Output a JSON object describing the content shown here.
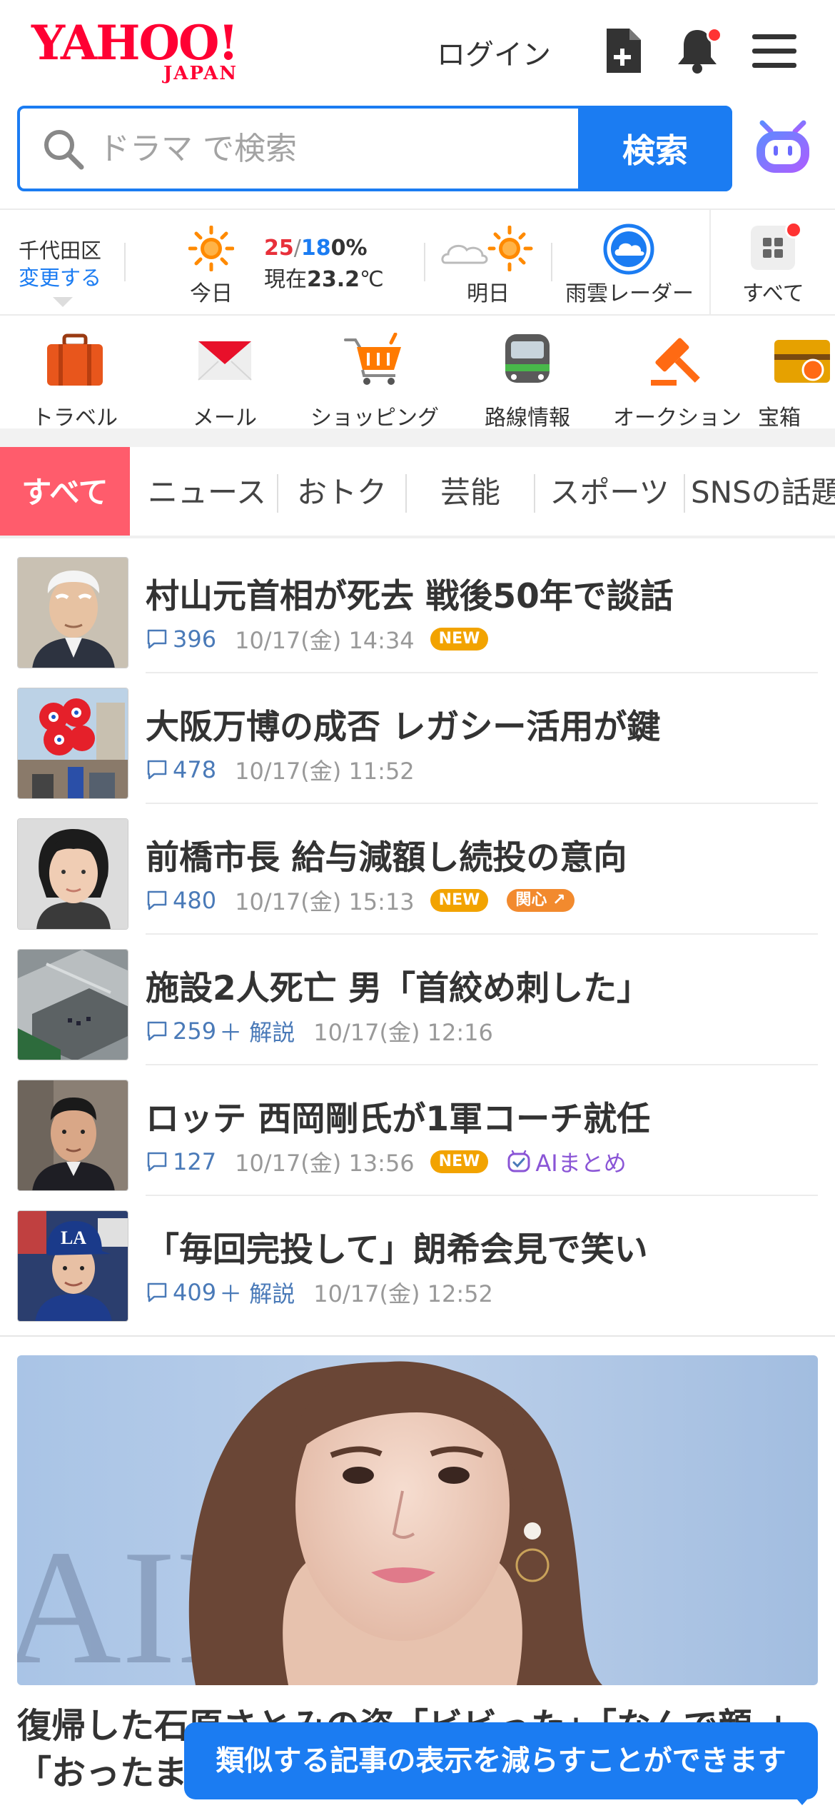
{
  "header": {
    "logo_main": "YAHOO!",
    "logo_sub": "JAPAN",
    "login_label": "ログイン",
    "icons": [
      "add-document-icon",
      "bell-icon",
      "hamburger-menu-icon"
    ]
  },
  "search": {
    "placeholder": "ドラマ で検索",
    "value": "",
    "button_label": "検索"
  },
  "weather": {
    "area": "千代田区",
    "change_label": "変更する",
    "today_label": "今日",
    "high": "25",
    "slash": "/",
    "low": "18",
    "rain": "0%",
    "now_prefix": "現在",
    "now_temp": "23.2",
    "now_unit": "℃",
    "tomorrow_label": "明日",
    "radar_label": "雨雲レーダー",
    "all_label": "すべて"
  },
  "services": [
    {
      "label": "トラベル",
      "icon": "suitcase-icon"
    },
    {
      "label": "メール",
      "icon": "mail-icon"
    },
    {
      "label": "ショッピング",
      "icon": "cart-icon"
    },
    {
      "label": "路線情報",
      "icon": "train-icon"
    },
    {
      "label": "オークション",
      "icon": "gavel-icon"
    },
    {
      "label": "宝箱",
      "icon": "treasure-box-icon"
    }
  ],
  "tabs": [
    {
      "label": "すべて",
      "active": true
    },
    {
      "label": "ニュース"
    },
    {
      "label": "おトク"
    },
    {
      "label": "芸能"
    },
    {
      "label": "スポーツ"
    },
    {
      "label": "SNSの話題"
    }
  ],
  "news": [
    {
      "title": "村山元首相が死去 戦後50年で談話",
      "comments": "396",
      "kaisetsu": "",
      "date": "10/17(金) 14:34",
      "new": "NEW",
      "kanshin": "",
      "ai": ""
    },
    {
      "title": "大阪万博の成否 レガシー活用が鍵",
      "comments": "478",
      "kaisetsu": "",
      "date": "10/17(金) 11:52",
      "new": "",
      "kanshin": "",
      "ai": ""
    },
    {
      "title": "前橋市長 給与減額し続投の意向",
      "comments": "480",
      "kaisetsu": "",
      "date": "10/17(金) 15:13",
      "new": "NEW",
      "kanshin": "関心",
      "ai": ""
    },
    {
      "title": "施設2人死亡 男「首絞め刺した」",
      "comments": "259",
      "kaisetsu": "＋ 解説",
      "date": "10/17(金) 12:16",
      "new": "",
      "kanshin": "",
      "ai": ""
    },
    {
      "title": "ロッテ 西岡剛氏が1軍コーチ就任",
      "comments": "127",
      "kaisetsu": "",
      "date": "10/17(金) 13:56",
      "new": "NEW",
      "kanshin": "",
      "ai": "AIまとめ"
    },
    {
      "title": "「毎回完投して」朗希会見で笑い",
      "comments": "409",
      "kaisetsu": "＋ 解説",
      "date": "10/17(金) 12:52",
      "new": "",
      "kanshin": "",
      "ai": ""
    }
  ],
  "feature": {
    "title_line1": "復帰した石原さとみの姿「ビビった」「なんで顔 +",
    "title_line2": "「おったま"
  },
  "toast": {
    "text": "類似する記事の表示を減らすことができます"
  },
  "colors": {
    "brand_red": "#ff0033",
    "accent_blue": "#1b7cf2",
    "active_tab": "#ff5c6c",
    "new_badge": "#f2a300",
    "kanshin_badge": "#f28a2e",
    "ai_purple": "#8a55d6"
  }
}
